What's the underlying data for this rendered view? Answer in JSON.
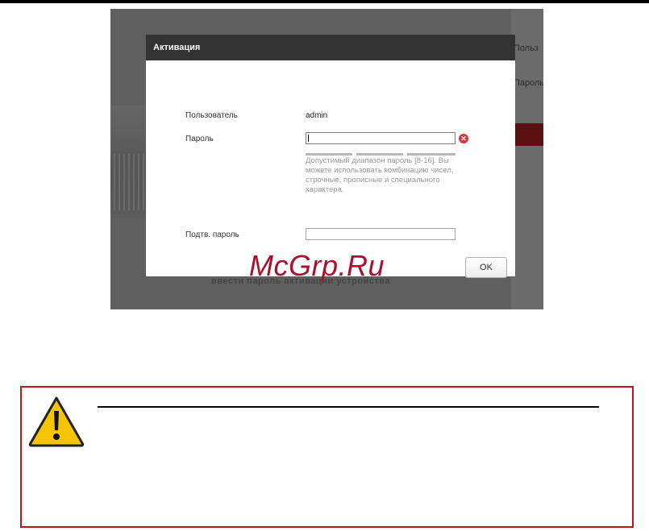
{
  "background_app": {
    "right_text_1": "Польз",
    "right_text_2": "Пароль",
    "bottom_text": "ввести пароль активации устройства"
  },
  "dialog": {
    "title": "Активация",
    "user_label": "Пользователь",
    "user_value": "admin",
    "password_label": "Пароль",
    "password_value": "",
    "password_hint": "Допустимый диапазон пароль [8-16]. Вы можете использовать комбинацию чисел, строчные, прописные и специального характера.",
    "confirm_label": "Подтв. пароль",
    "confirm_value": "",
    "ok_label": "OK",
    "error_icon": "error-x-icon"
  },
  "watermark": "McGrp.Ru",
  "warning": {
    "icon": "warning-triangle-icon",
    "accent": "#c8101a",
    "icon_color": "#f5c400"
  }
}
